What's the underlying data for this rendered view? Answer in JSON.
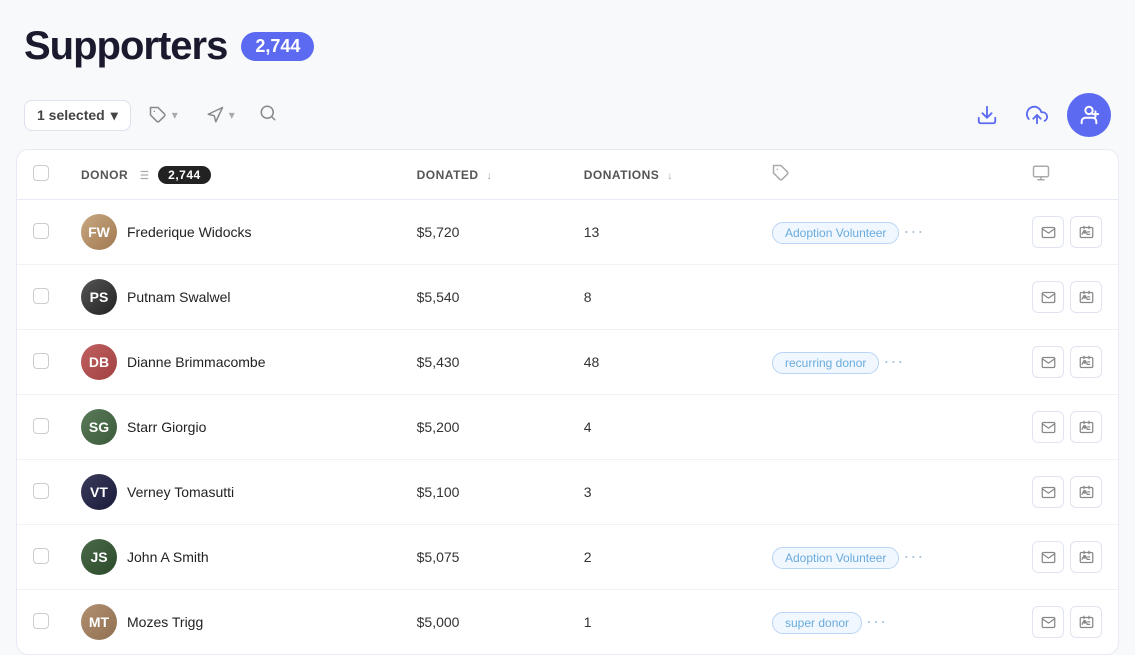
{
  "header": {
    "title": "Supporters",
    "count": "2,744"
  },
  "toolbar": {
    "selected_label": "1 selected",
    "selected_dropdown": true,
    "tag_label": "",
    "announce_label": "",
    "search_label": "",
    "download_icon": "⬇",
    "upload_icon": "⬆",
    "add_user_icon": "+"
  },
  "table": {
    "columns": [
      {
        "id": "donor",
        "label": "DONOR",
        "sort": true
      },
      {
        "id": "donated",
        "label": "DONATED",
        "sort": true
      },
      {
        "id": "donations",
        "label": "DONATIONS",
        "sort": true
      },
      {
        "id": "tags",
        "label": ""
      },
      {
        "id": "actions",
        "label": ""
      }
    ],
    "donor_count_badge": "2,744",
    "rows": [
      {
        "id": 1,
        "name": "Frederique Widocks",
        "avatar_class": "avatar-1",
        "avatar_initials": "FW",
        "donated": "$5,720",
        "donations": "13",
        "tags": [
          "Adoption Volunteer"
        ],
        "has_more": true
      },
      {
        "id": 2,
        "name": "Putnam Swalwel",
        "avatar_class": "avatar-2",
        "avatar_initials": "PS",
        "donated": "$5,540",
        "donations": "8",
        "tags": [],
        "has_more": false
      },
      {
        "id": 3,
        "name": "Dianne Brimmacombe",
        "avatar_class": "avatar-3",
        "avatar_initials": "DB",
        "donated": "$5,430",
        "donations": "48",
        "tags": [
          "recurring donor"
        ],
        "has_more": true
      },
      {
        "id": 4,
        "name": "Starr Giorgio",
        "avatar_class": "avatar-4",
        "avatar_initials": "SG",
        "donated": "$5,200",
        "donations": "4",
        "tags": [],
        "has_more": false
      },
      {
        "id": 5,
        "name": "Verney Tomasutti",
        "avatar_class": "avatar-5",
        "avatar_initials": "VT",
        "donated": "$5,100",
        "donations": "3",
        "tags": [],
        "has_more": false
      },
      {
        "id": 6,
        "name": "John A Smith",
        "avatar_class": "avatar-6",
        "avatar_initials": "JS",
        "donated": "$5,075",
        "donations": "2",
        "tags": [
          "Adoption Volunteer"
        ],
        "has_more": true
      },
      {
        "id": 7,
        "name": "Mozes Trigg",
        "avatar_class": "avatar-7",
        "avatar_initials": "MT",
        "donated": "$5,000",
        "donations": "1",
        "tags": [
          "super donor"
        ],
        "has_more": true
      }
    ]
  }
}
